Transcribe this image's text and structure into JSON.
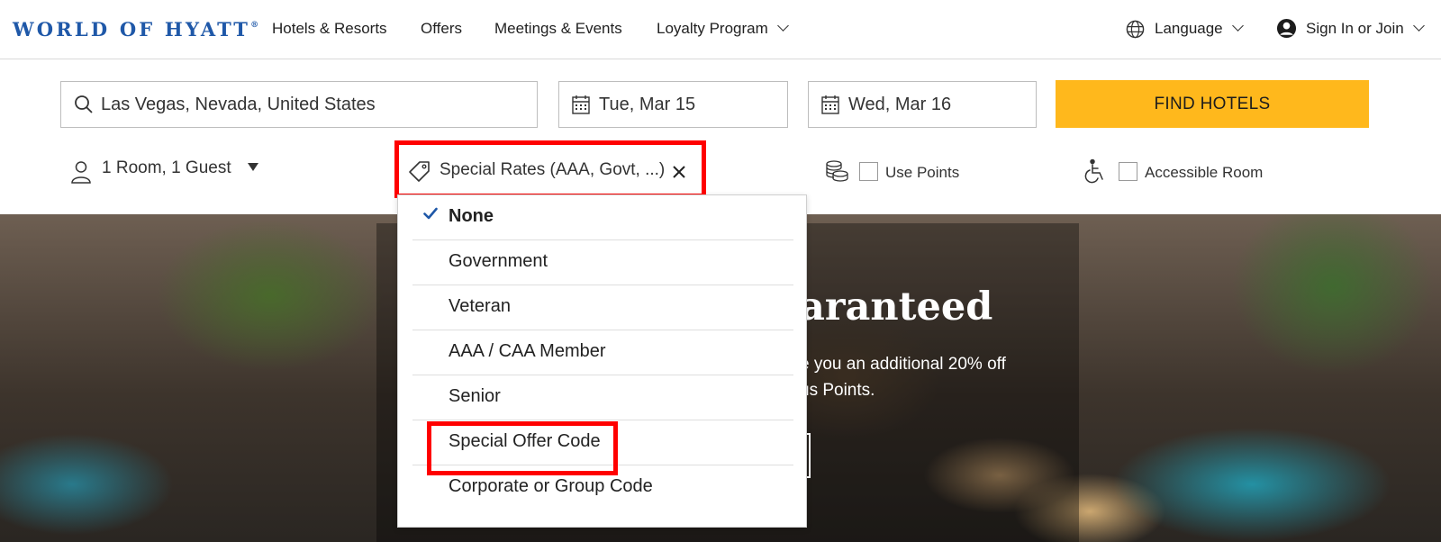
{
  "brand": {
    "logo_text": "WORLD OF HYATT",
    "logo_mark": "®"
  },
  "nav": {
    "links": [
      "Hotels & Resorts",
      "Offers",
      "Meetings & Events",
      "Loyalty Program"
    ],
    "language": "Language",
    "signin": "Sign In or Join"
  },
  "search": {
    "destination": "Las Vegas, Nevada, United States",
    "checkin": "Tue, Mar 15",
    "checkout": "Wed, Mar 16",
    "find_label": "FIND HOTELS",
    "rooms_guests": "1 Room, 1 Guest",
    "special_rates": "Special Rates (AAA, Govt, ...)",
    "use_points": "Use Points",
    "accessible_room": "Accessible Room"
  },
  "hero": {
    "title_fragment": "aranteed",
    "text_line1": "e you an additional 20% off",
    "text_line2": "us Points."
  },
  "rates_menu": {
    "options": [
      {
        "label": "None",
        "selected": true
      },
      {
        "label": "Government",
        "selected": false
      },
      {
        "label": "Veteran",
        "selected": false
      },
      {
        "label": "AAA / CAA Member",
        "selected": false
      },
      {
        "label": "Senior",
        "selected": false
      },
      {
        "label": "Special Offer Code",
        "selected": false
      },
      {
        "label": "Corporate or Group Code",
        "selected": false
      }
    ]
  },
  "colors": {
    "brand_blue": "#1f58a8",
    "find_button": "#ffb81c",
    "annotation_red": "#ff0000",
    "check_blue": "#1f58a8"
  }
}
